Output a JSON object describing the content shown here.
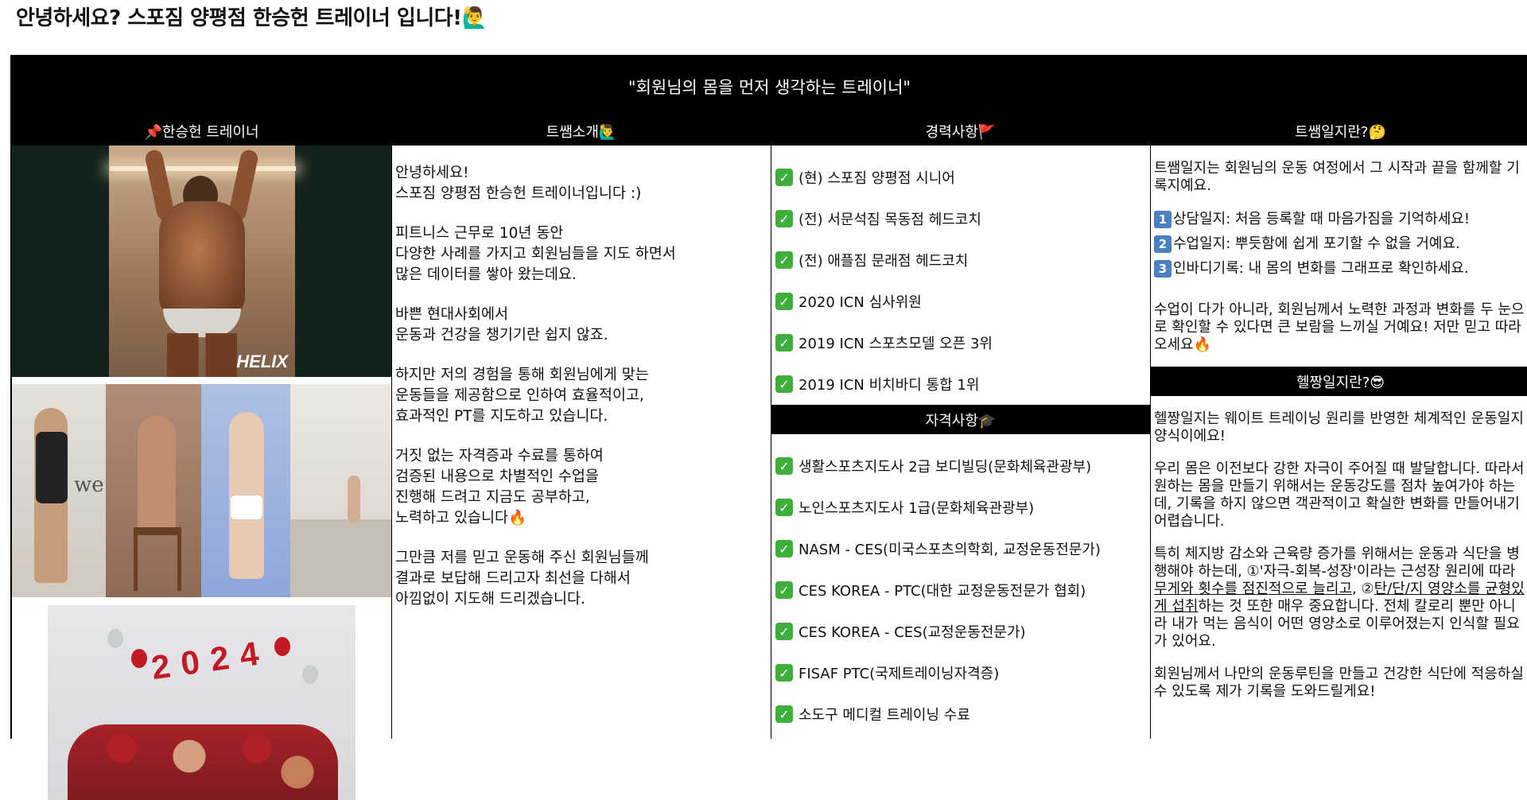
{
  "title": "안녕하세요? 스포짐 양평점 한승헌 트레이너 입니다!🙋‍♂️",
  "banner": "\"회원님의 몸을 먼저 생각하는 트레이너\"",
  "col1": {
    "header": "📌한승헌 트레이너",
    "brand": "HELIX",
    "overlay_text": "we",
    "poster_number": "2024"
  },
  "col2": {
    "header": "트쌤소개🙋‍♂️",
    "paragraphs": [
      [
        "안녕하세요!",
        "스포짐 양평점 한승헌 트레이너입니다 :)"
      ],
      [
        "피트니스 근무로 10년 동안",
        "다양한 사례를 가지고 회원님들을 지도 하면서",
        "많은 데이터를 쌓아 왔는데요."
      ],
      [
        "바쁜 현대사회에서",
        "운동과 건강을 챙기기란 쉽지 않죠."
      ],
      [
        "하지만 저의 경험을 통해 회원님에게 맞는",
        "운동들을 제공함으로 인하여 효율적이고,",
        "효과적인 PT를 지도하고 있습니다."
      ],
      [
        "거짓 없는 자격증과 수료를 통하여",
        "검증된 내용으로 차별적인 수업을",
        "진행해 드려고 지금도 공부하고,",
        "노력하고 있습니다🔥"
      ],
      [
        "그만큼 저를 믿고 운동해 주신 회원님들께",
        "결과로 보답해 드리고자 최선을 다해서",
        "아낌없이 지도해 드리겠습니다."
      ]
    ]
  },
  "col3": {
    "header": "경력사항🚩",
    "career": [
      "(현) 스포짐 양평점 시니어",
      "(전) 서문석짐 목동점 헤드코치",
      "(전) 애플짐 문래점 헤드코치",
      "2020 ICN 심사위원",
      "2019 ICN 스포츠모델 오픈 3위",
      "2019 ICN 비치바디 통합 1위"
    ],
    "header2": "자격사항🎓",
    "certs": [
      "생활스포츠지도사 2급 보디빌딩(문화체육관광부)",
      "노인스포츠지도사 1급(문화체육관광부)",
      "NASM - CES(미국스포츠의학회, 교정운동전문가)",
      "CES KOREA - PTC(대한 교정운동전문가 협회)",
      "CES KOREA - CES(교정운동전문가)",
      "FISAF PTC(국제트레이닝자격증)",
      "소도구 메디컬 트레이닝 수료"
    ],
    "check": "✓"
  },
  "col4": {
    "header": "트쌤일지란?🤔",
    "intro": "트쌤일지는 회원님의 운동 여정에서 그 시작과 끝을 함께할 기록지예요.",
    "items": [
      {
        "num": "1",
        "text": "상담일지: 처음 등록할 때 마음가짐을 기억하세요!"
      },
      {
        "num": "2",
        "text": "수업일지: 뿌듯함에 쉽게 포기할 수 없을 거예요."
      },
      {
        "num": "3",
        "text": "인바디기록: 내 몸의 변화를 그래프로 확인하세요."
      }
    ],
    "outro": "수업이 다가 아니라, 회원님께서 노력한 과정과 변화를 두 눈으로 확인할 수 있다면 큰 보람을 느끼실 거예요! 저만 믿고 따라오세요🔥",
    "header2": "헬짱일지란?😎",
    "p1": "헬짱일지는 웨이트 트레이닝 원리를 반영한 체계적인 운동일지 양식이에요!",
    "p2": "우리 몸은 이전보다 강한 자극이 주어질 때 발달합니다. 따라서 원하는 몸을 만들기 위해서는 운동강도를 점차 높여가야 하는데, 기록을 하지 않으면 객관적이고 확실한 변화를 만들어내기 어렵습니다.",
    "p3_a": "특히 체지방 감소와 근육량 증가를 위해서는 운동과 식단을 병행해야 하는데, ①'자극-회복-성장'이라는 근성장 원리에 따라 ",
    "p3_u1": "무게와 횟수를 점진적으로 늘리고",
    "p3_b": ", ②",
    "p3_u2": "탄/단/지 영양소를 균형있게 섭취",
    "p3_c": "하는 것 또한 매우 중요합니다. 전체 칼로리 뿐만 아니라 내가 먹는 음식이 어떤 영양소로 이루어졌는지 인식할 필요가 있어요.",
    "p4": "회원님께서 나만의 운동루틴을 만들고 건강한 식단에 적응하실 수 있도록 제가 기록을 도와드릴게요!"
  }
}
